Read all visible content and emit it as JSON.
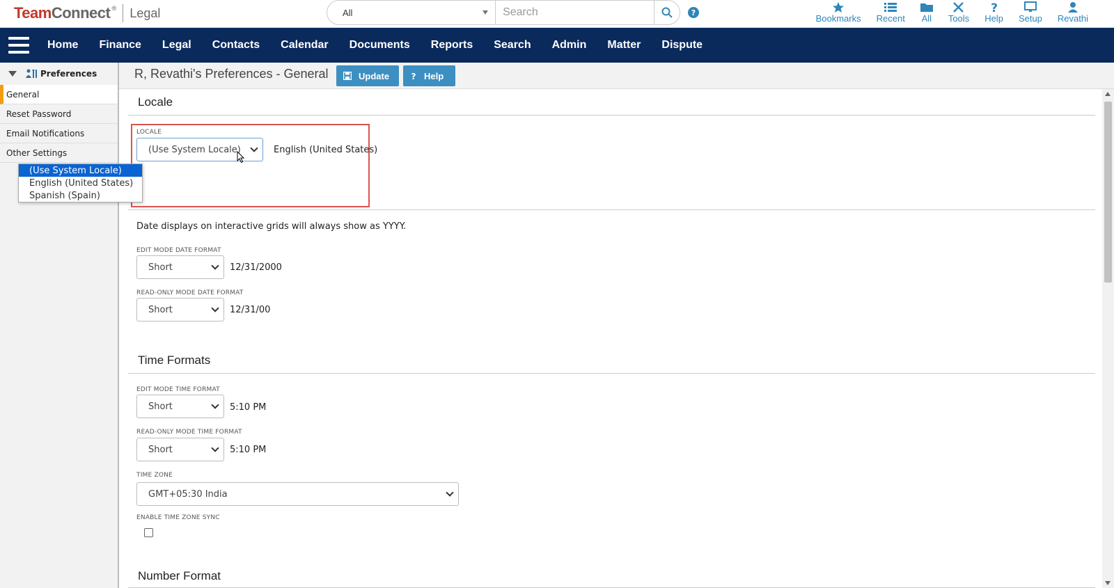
{
  "app": {
    "logo_team": "Team",
    "logo_connect": "Connect",
    "logo_reg": "®",
    "logo_product": "Legal"
  },
  "search": {
    "scope": "All",
    "placeholder": "Search"
  },
  "toolbar": [
    {
      "label": "Bookmarks",
      "icon": "star-icon"
    },
    {
      "label": "Recent",
      "icon": "list-icon"
    },
    {
      "label": "All",
      "icon": "folder-icon"
    },
    {
      "label": "Tools",
      "icon": "tools-icon"
    },
    {
      "label": "Help",
      "icon": "question-icon"
    },
    {
      "label": "Setup",
      "icon": "monitor-icon"
    },
    {
      "label": "Revathi",
      "icon": "user-icon"
    }
  ],
  "nav": [
    "Home",
    "Finance",
    "Legal",
    "Contacts",
    "Calendar",
    "Documents",
    "Reports",
    "Search",
    "Admin",
    "Matter",
    "Dispute"
  ],
  "sidebar": {
    "header": "Preferences",
    "items": [
      "General",
      "Reset Password",
      "Email Notifications",
      "Other Settings"
    ]
  },
  "page": {
    "title": "R, Revathi's Preferences - General",
    "update_label": "Update",
    "help_label": "Help"
  },
  "locale": {
    "section_title": "Locale",
    "label": "LOCALE",
    "selected": "(Use System Locale)",
    "resolved": "English (United States)",
    "options": [
      "(Use System Locale)",
      "English (United States)",
      "Spanish (Spain)"
    ]
  },
  "date": {
    "note": "Date displays on interactive grids will always show as YYYY.",
    "edit_label": "EDIT MODE DATE FORMAT",
    "edit_value": "Short",
    "edit_example": "12/31/2000",
    "read_label": "READ-ONLY MODE DATE FORMAT",
    "read_value": "Short",
    "read_example": "12/31/00"
  },
  "time": {
    "section_title": "Time Formats",
    "edit_label": "EDIT MODE TIME FORMAT",
    "edit_value": "Short",
    "edit_example": "5:10 PM",
    "read_label": "READ-ONLY MODE TIME FORMAT",
    "read_value": "Short",
    "read_example": "5:10 PM",
    "tz_label": "TIME ZONE",
    "tz_value": "GMT+05:30 India",
    "sync_label": "ENABLE TIME ZONE SYNC"
  },
  "number": {
    "section_title": "Number Format"
  },
  "colors": {
    "nav_bg": "#0a2a5c",
    "accent": "#3d8fc1",
    "brand_red": "#c0392b",
    "highlight": "#d9534f",
    "active_marker": "#f39c12"
  }
}
